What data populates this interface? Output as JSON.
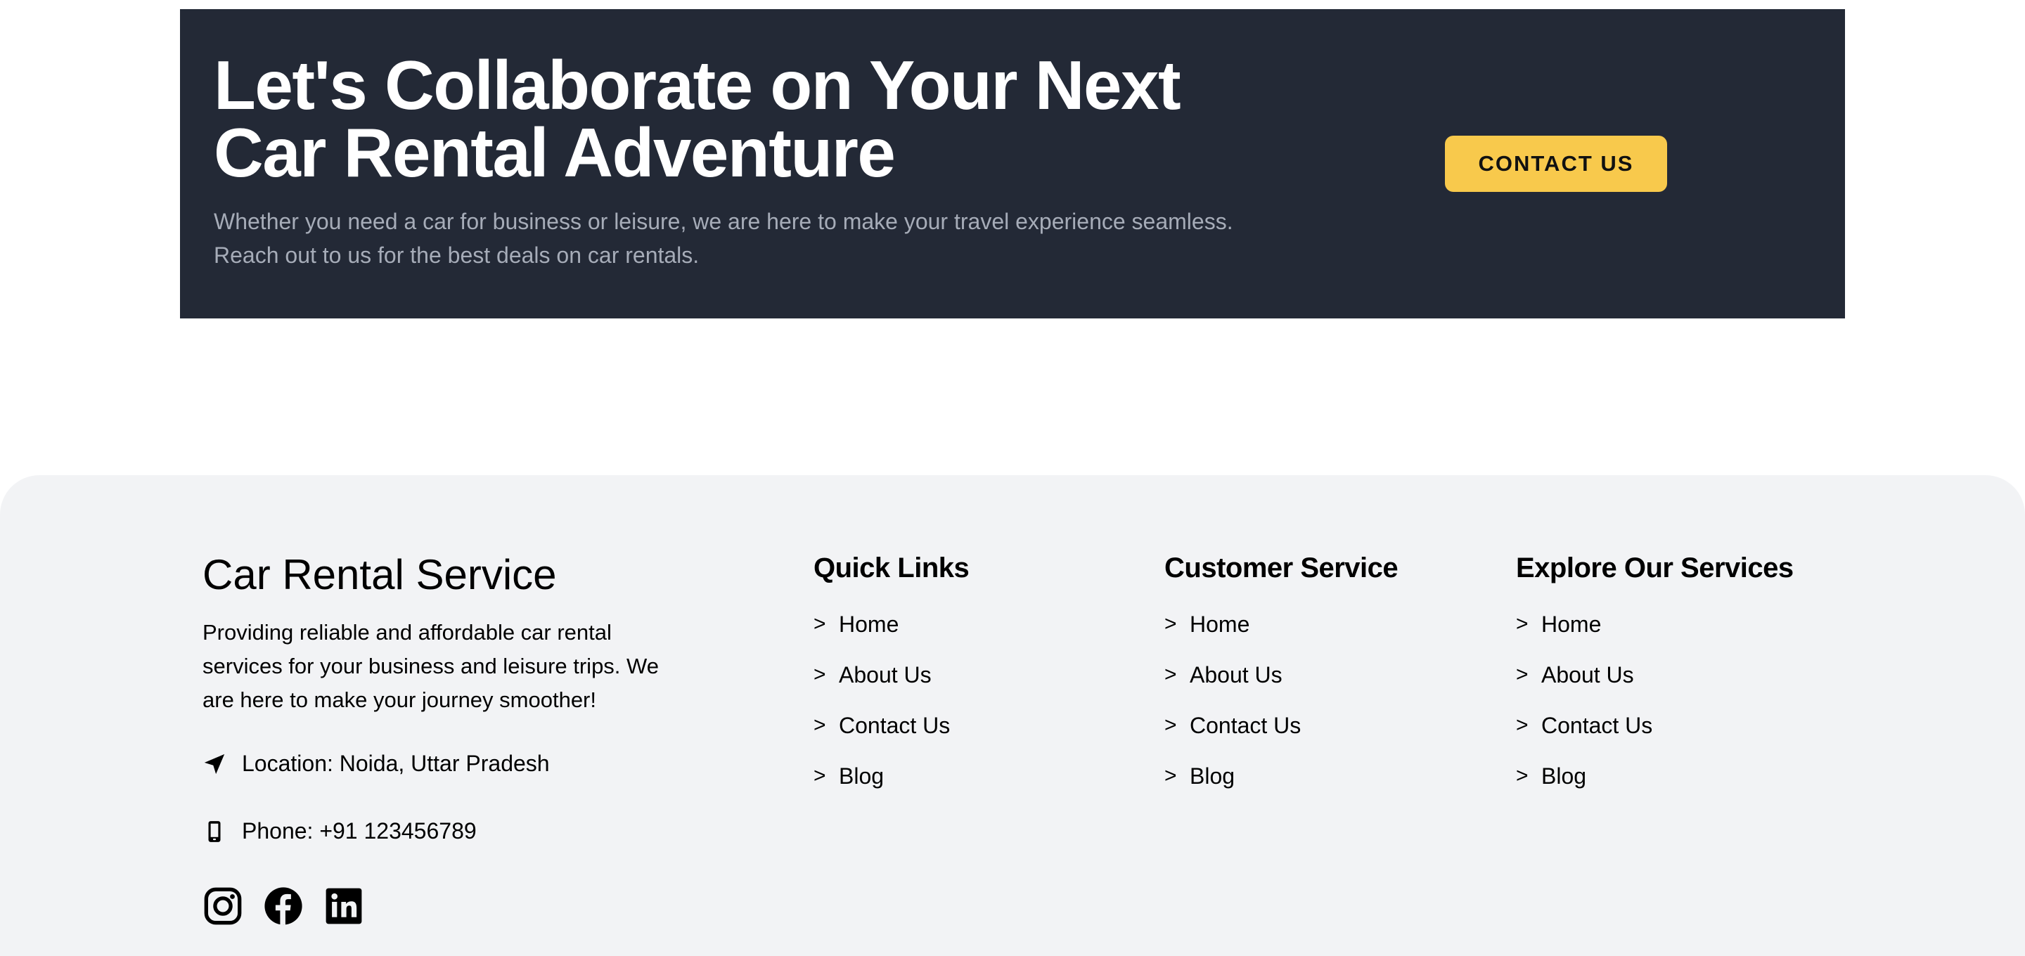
{
  "cta": {
    "heading_line1": "Let's Collaborate on Your Next",
    "heading_line2": "Car Rental Adventure",
    "text_line1": "Whether you need a car for business or leisure, we are here to make your travel experience seamless.",
    "text_line2": "Reach out to us for the best deals on car rentals.",
    "button_label": "CONTACT US",
    "background_color": "#232936",
    "button_color": "#f8c94c"
  },
  "footer": {
    "background_color": "#f2f3f5",
    "brand": {
      "title": "Car Rental Service",
      "desc_line1": "Providing reliable and affordable car rental",
      "desc_line2": "services for your business and leisure trips. We",
      "desc_line3": "are here to make your journey smoother!"
    },
    "location": {
      "icon": "location-arrow-icon",
      "text": "Location: Noida, Uttar Pradesh"
    },
    "phone": {
      "icon": "mobile-phone-icon",
      "text": "Phone: +91 123456789"
    },
    "socials": [
      "instagram-icon",
      "facebook-icon",
      "linkedin-icon"
    ],
    "columns": [
      {
        "title": "Quick Links",
        "items": [
          "Home",
          "About Us",
          "Contact Us",
          "Blog"
        ]
      },
      {
        "title": "Customer Service",
        "items": [
          "Home",
          "About Us",
          "Contact Us",
          "Blog"
        ]
      },
      {
        "title": "Explore Our Services",
        "items": [
          "Home",
          "About Us",
          "Contact Us",
          "Blog"
        ]
      }
    ],
    "link_prefix": ">"
  }
}
